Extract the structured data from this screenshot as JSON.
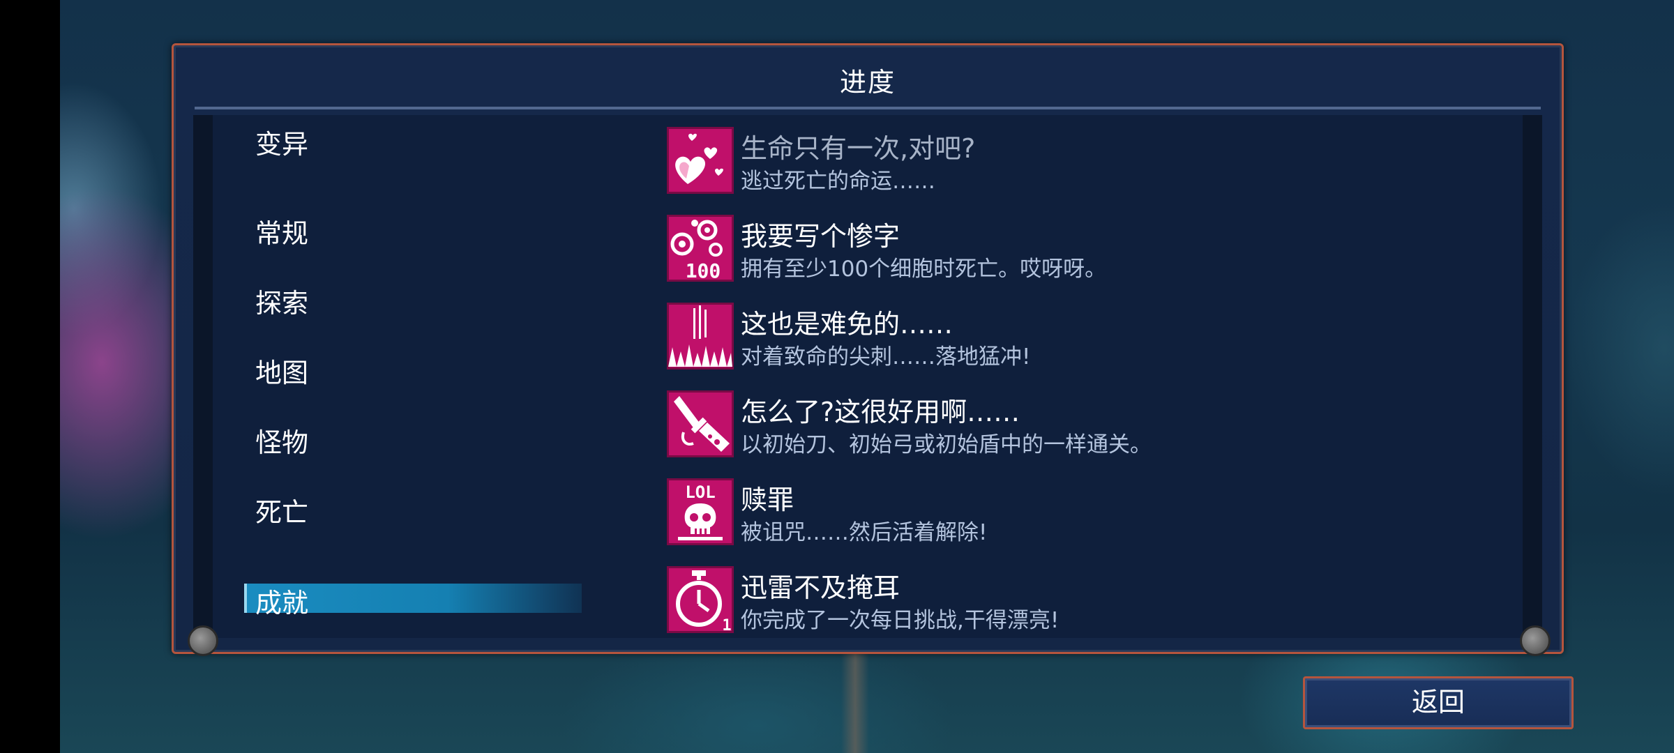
{
  "panel": {
    "title": "进度"
  },
  "categories": [
    {
      "label": "变异",
      "selected": false
    },
    {
      "label": "常规",
      "selected": false
    },
    {
      "label": "探索",
      "selected": false
    },
    {
      "label": "地图",
      "selected": false
    },
    {
      "label": "怪物",
      "selected": false
    },
    {
      "label": "死亡",
      "selected": false
    },
    {
      "label": "成就",
      "selected": true
    }
  ],
  "achievements": [
    {
      "title": "生命只有一次,对吧?",
      "description": "逃过死亡的命运……",
      "icon": "hearts-icon",
      "unlocked": false
    },
    {
      "title": "我要写个惨字",
      "description": "拥有至少100个细胞时死亡。哎呀呀。",
      "icon": "cells-100-icon",
      "icon_text": "100",
      "unlocked": true
    },
    {
      "title": "这也是难免的……",
      "description": "对着致命的尖刺……落地猛冲!",
      "icon": "spikes-icon",
      "unlocked": true
    },
    {
      "title": "怎么了?这很好用啊……",
      "description": "以初始刀、初始弓或初始盾中的一样通关。",
      "icon": "sword-icon",
      "unlocked": true
    },
    {
      "title": "赎罪",
      "description": "被诅咒……然后活着解除!",
      "icon": "lol-skull-icon",
      "icon_text": "LOL",
      "unlocked": true
    },
    {
      "title": "迅雷不及掩耳",
      "description": "你完成了一次每日挑战,干得漂亮!",
      "icon": "stopwatch-icon",
      "icon_text": "1",
      "unlocked": true
    }
  ],
  "footer": {
    "back_label": "返回"
  },
  "colors": {
    "accent_border": "#b5553d",
    "selected_tab": "#1a8cc0",
    "icon_bg": "#c0106a"
  }
}
